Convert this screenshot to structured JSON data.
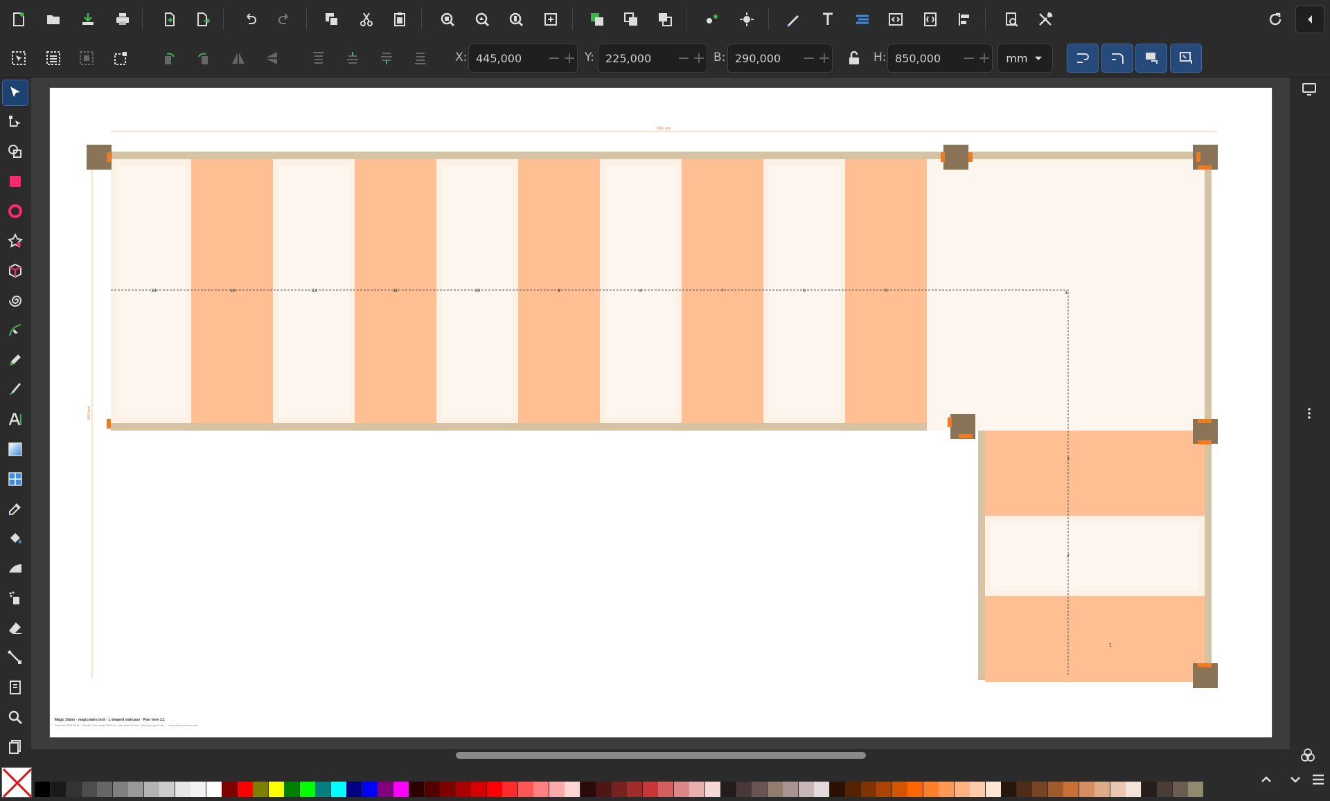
{
  "controls": {
    "x_label": "X:",
    "x_value": "445,000",
    "y_label": "Y:",
    "y_value": "225,000",
    "w_label": "B:",
    "w_value": "290,000",
    "h_label": "H:",
    "h_value": "850,000",
    "unit": "mm",
    "minus": "−",
    "plus": "+"
  },
  "drawing": {
    "top_dimension": "2600 mm",
    "left_dimension": "1050 mm",
    "step_numbers": [
      "14",
      "13",
      "12",
      "11",
      "10",
      "9",
      "8",
      "7",
      "6",
      "5",
      "4",
      "3",
      "2",
      "1"
    ],
    "title_block": "Magic Stairs · magicstairs.tech · L-shaped staircase · Plan view 1:1",
    "title_sub": "Generated 2025-06-18 · 14 treads · floor height 2800 mm · stair width 900 mm · planning support only — verify all dimensions on site"
  },
  "colors": {
    "accent": "#1d4170",
    "tread_orange": "#ffbf93",
    "tread_light": "#fcf6ef",
    "stringer": "#d6c3a4",
    "post": "#8a7458",
    "marker": "#f07a20"
  },
  "icons": {
    "toolbar": [
      "new-document-icon",
      "open-icon",
      "save-icon",
      "print-icon",
      "import-icon",
      "export-icon",
      "undo-icon",
      "redo-icon",
      "duplicate-icon",
      "cut-icon",
      "paste-icon",
      "zoom-selection-icon",
      "zoom-drawing-icon",
      "zoom-page-icon",
      "zoom-center-icon",
      "group-icon",
      "ungroup-icon",
      "clone-icon",
      "node-snap-icon",
      "snap-icon",
      "xml-pen-icon",
      "text-icon",
      "layers-icon",
      "xml-editor-icon",
      "objects-icon",
      "align-icon",
      "document-props-icon",
      "preferences-icon",
      "sync-icon",
      "collapse-icon"
    ],
    "tools": [
      "selector-icon",
      "node-tool-icon",
      "shape-builder-icon",
      "rectangle-icon",
      "circle-icon",
      "star-icon",
      "box3d-icon",
      "spiral-icon",
      "bezier-icon",
      "pencil-icon",
      "calligraphy-icon",
      "text-tool-icon",
      "gradient-icon",
      "mesh-icon",
      "dropper-icon",
      "paint-bucket-icon",
      "tweak-icon",
      "spray-icon",
      "eraser-icon",
      "connector-icon",
      "pages-icon",
      "zoom-tool-icon",
      "measure-icon"
    ]
  }
}
